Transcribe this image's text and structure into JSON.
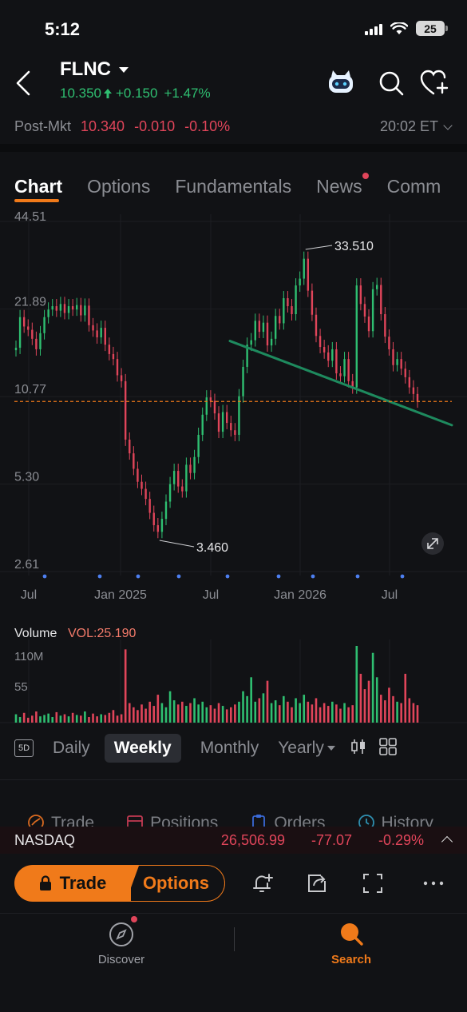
{
  "status_bar": {
    "time": "5:12",
    "battery": "25"
  },
  "header": {
    "ticker": "FLNC",
    "price": "10.350",
    "change": "+0.150",
    "change_pct": "+1.47%"
  },
  "post_market": {
    "label": "Post-Mkt",
    "price": "10.340",
    "change": "-0.010",
    "change_pct": "-0.10%",
    "time": "20:02 ET"
  },
  "tabs": [
    {
      "label": "Chart"
    },
    {
      "label": "Options"
    },
    {
      "label": "Fundamentals"
    },
    {
      "label": "News"
    },
    {
      "label": "Comm"
    }
  ],
  "chart_data": {
    "type": "candlestick",
    "scale": "log",
    "y_ticks": [
      44.51,
      21.89,
      10.77,
      5.3,
      2.61
    ],
    "y_tick_labels": [
      "44.51",
      "21.89",
      "10.77",
      "5.30",
      "2.61"
    ],
    "x_tick_labels": [
      "Jul",
      "Jan 2025",
      "Jul",
      "Jan 2026",
      "Jul"
    ],
    "current_price_line": 10.35,
    "annotations": {
      "high": "33.510",
      "low": "3.460"
    },
    "series": [
      {
        "name": "weekly close",
        "values": [
          16.0,
          20.5,
          19.0,
          18.5,
          17.2,
          15.8,
          18.0,
          20.5,
          21.8,
          22.4,
          21.6,
          22.8,
          21.2,
          22.4,
          21.8,
          22.6,
          20.8,
          22.5,
          19.2,
          18.4,
          17.4,
          18.8,
          16.4,
          15.2,
          14.6,
          12.8,
          12.2,
          7.6,
          6.8,
          6.0,
          5.4,
          5.1,
          4.7,
          4.2,
          3.8,
          3.6,
          4.0,
          4.6,
          5.3,
          5.9,
          5.2,
          5.0,
          6.2,
          5.8,
          6.6,
          7.9,
          9.3,
          10.7,
          10.4,
          9.4,
          8.1,
          9.5,
          8.7,
          8.2,
          7.9,
          10.8,
          13.7,
          16.4,
          17.0,
          19.9,
          18.2,
          19.6,
          16.3,
          17.2,
          20.7,
          19.5,
          23.9,
          22.4,
          21.0,
          26.5,
          28.0,
          32.9,
          25.4,
          20.9,
          17.6,
          16.1,
          15.4,
          14.4,
          15.8,
          13.0,
          12.7,
          14.6,
          12.2,
          11.6,
          26.5,
          22.8,
          20.6,
          18.3,
          25.7,
          26.6,
          21.0,
          17.5,
          15.8,
          13.9,
          14.6,
          13.5,
          12.6,
          11.6,
          11.0,
          10.35
        ]
      }
    ],
    "trendline": {
      "from": 16.9,
      "to": 9.6
    },
    "volume": {
      "label": "Volume",
      "value_label": "VOL:25.190",
      "y_ticks": [
        "110M",
        "55"
      ],
      "values": [
        12,
        8,
        14,
        7,
        10,
        16,
        9,
        11,
        13,
        8,
        15,
        10,
        12,
        9,
        14,
        11,
        10,
        16,
        8,
        13,
        9,
        12,
        11,
        14,
        18,
        10,
        12,
        105,
        28,
        22,
        18,
        26,
        20,
        30,
        24,
        40,
        28,
        22,
        45,
        32,
        26,
        30,
        24,
        28,
        35,
        26,
        30,
        22,
        25,
        20,
        28,
        24,
        19,
        22,
        26,
        30,
        45,
        38,
        65,
        30,
        35,
        42,
        60,
        28,
        32,
        25,
        38,
        30,
        22,
        35,
        28,
        40,
        30,
        26,
        35,
        22,
        28,
        24,
        30,
        26,
        20,
        28,
        22,
        25,
        110,
        70,
        48,
        60,
        100,
        65,
        40,
        32,
        50,
        38,
        30,
        28,
        70,
        35,
        28,
        25
      ],
      "colors_up_down": true
    }
  },
  "period_bar": {
    "five_day": "5D",
    "options": [
      {
        "label": "Daily"
      },
      {
        "label": "Weekly"
      },
      {
        "label": "Monthly"
      },
      {
        "label": "Yearly"
      }
    ]
  },
  "action_row": [
    {
      "label": "Trade"
    },
    {
      "label": "Positions"
    },
    {
      "label": "Orders"
    },
    {
      "label": "History"
    }
  ],
  "index_bar": {
    "name": "NASDAQ",
    "value": "26,506.99",
    "change": "-77.07",
    "change_pct": "-0.29%"
  },
  "trade_row": {
    "trade_label": "Trade",
    "options_label": "Options"
  },
  "bottom_nav": {
    "discover": "Discover",
    "search": "Search"
  },
  "colors": {
    "up": "#2fbf71",
    "down": "#e0455a",
    "accent": "#f07a1a",
    "trend": "#1e8a5e"
  }
}
